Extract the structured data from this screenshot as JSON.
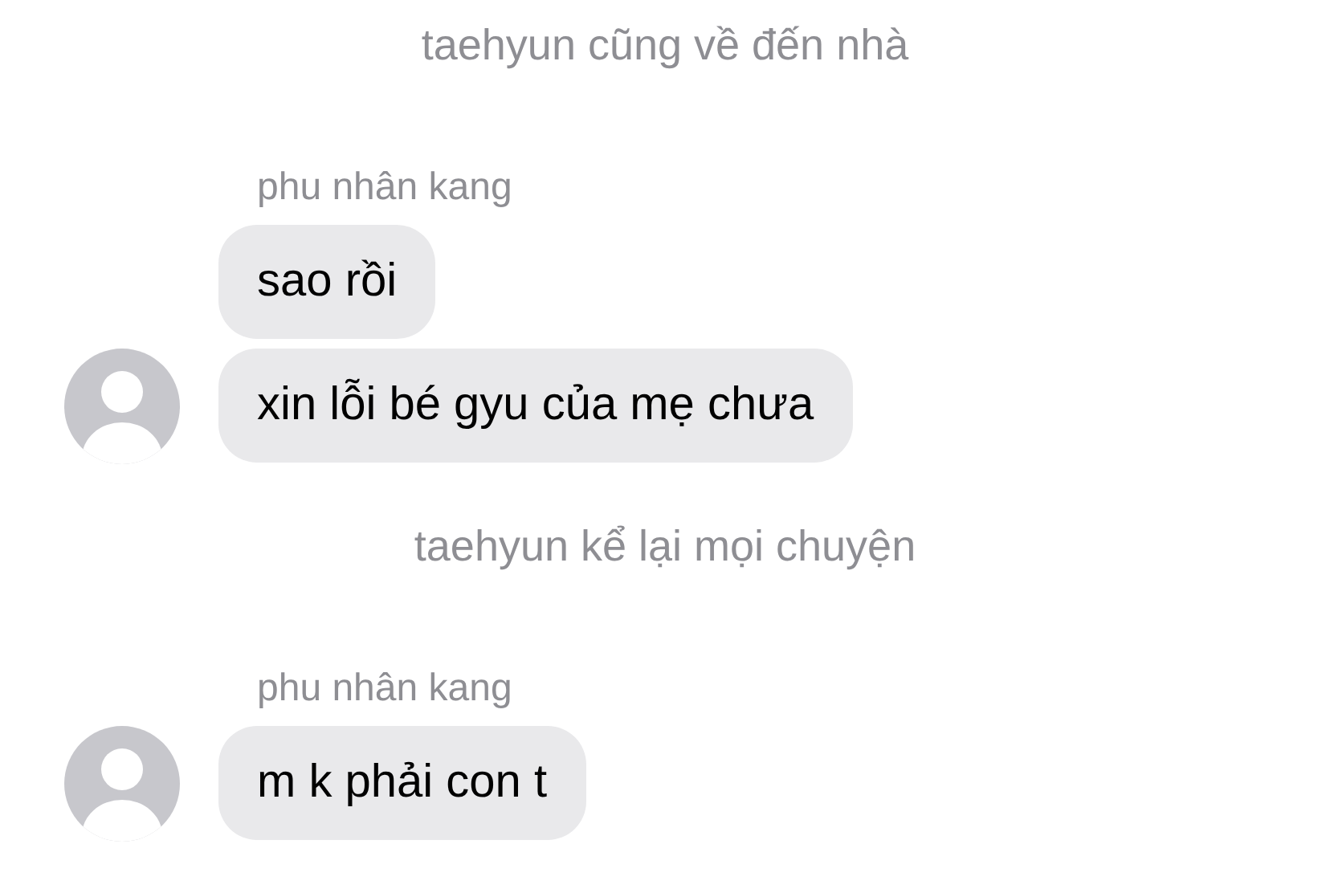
{
  "items": [
    {
      "kind": "notice",
      "text": "taehyun cũng về đến nhà"
    },
    {
      "kind": "group",
      "sender": "phu nhân kang",
      "messages": [
        "sao rồi",
        "xin lỗi bé gyu của mẹ chưa"
      ]
    },
    {
      "kind": "notice",
      "text": "taehyun kể lại mọi chuyện"
    },
    {
      "kind": "group",
      "sender": "phu nhân kang",
      "messages": [
        "m k phải con t"
      ]
    }
  ]
}
